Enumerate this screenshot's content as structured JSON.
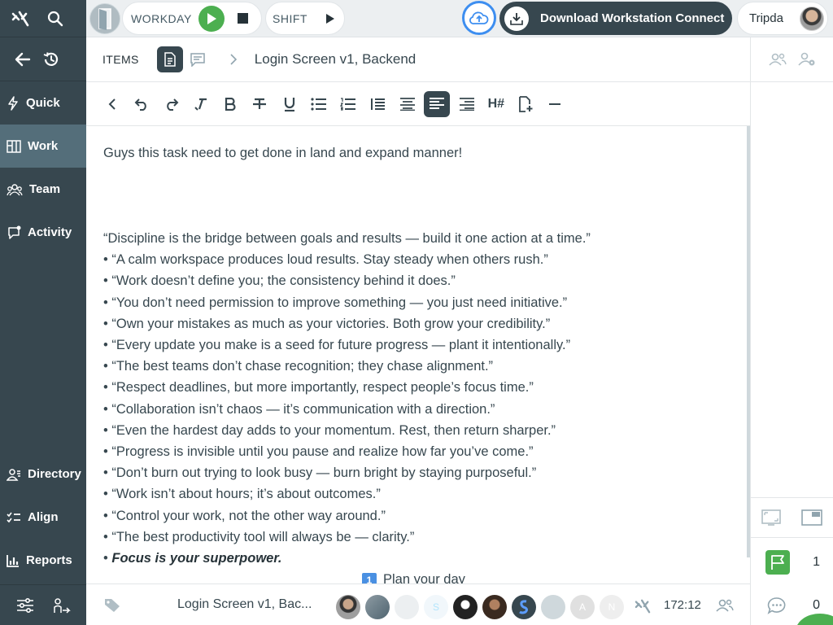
{
  "sidebar": {
    "quick": "Quick",
    "work": "Work",
    "team": "Team",
    "activity": "Activity",
    "directory": "Directory",
    "align": "Align",
    "reports": "Reports"
  },
  "topbar": {
    "workday": "WORKDAY",
    "shift": "SHIFT",
    "download": "Download Workstation Connect",
    "user": "Tripda"
  },
  "breadcrumb": {
    "items": "ITEMS",
    "title": "Login Screen v1, Backend"
  },
  "toolbar": {
    "heading_label": "H#"
  },
  "content": {
    "intro": "Guys this task need to get done in land and expand manner!",
    "quotes": [
      "“Discipline is the bridge between goals and results — build it one action at a time.”",
      "• “A calm workspace produces loud results. Stay steady when others rush.”",
      "• “Work doesn’t define you; the consistency behind it does.”",
      "• “You don’t need permission to improve something — you just need initiative.”",
      "• “Own your mistakes as much as your victories. Both grow your credibility.”",
      "• “Every update you make is a seed for future progress — plant it intentionally.”",
      "• “The best teams don’t chase recognition; they chase alignment.”",
      "• “Respect deadlines, but more importantly, respect people’s focus time.”",
      "• “Collaboration isn’t chaos — it’s communication with a direction.”",
      "• “Even the hardest day adds to your momentum. Rest, then return sharper.”",
      "• “Progress is invisible until you pause and realize how far you’ve come.”",
      "• “Don’t burn out trying to look busy — burn bright by staying purposeful.”",
      "• “Work isn’t about hours; it’s about outcomes.”",
      "• “Control your work, not the other way around.”",
      "• “The best productivity tool will always be — clarity.”"
    ],
    "last_prefix": "• ",
    "last_emphasis": "Focus is your superpower.",
    "plan_number": "1",
    "plan_text": "Plan your day"
  },
  "bottombar": {
    "title": "Login Screen v1, Bac...",
    "avatar_letter_a": "A",
    "avatar_letter_n": "N",
    "avatar_letter_s": "S",
    "timer": "172:12"
  },
  "right_panel": {
    "flag_count": "1",
    "comment_count": "0"
  },
  "colors": {
    "sidebar": "#37474f",
    "sidebar_active": "#546e7a",
    "accent_green": "#4caf50",
    "accent_blue": "#3d8ef0"
  }
}
